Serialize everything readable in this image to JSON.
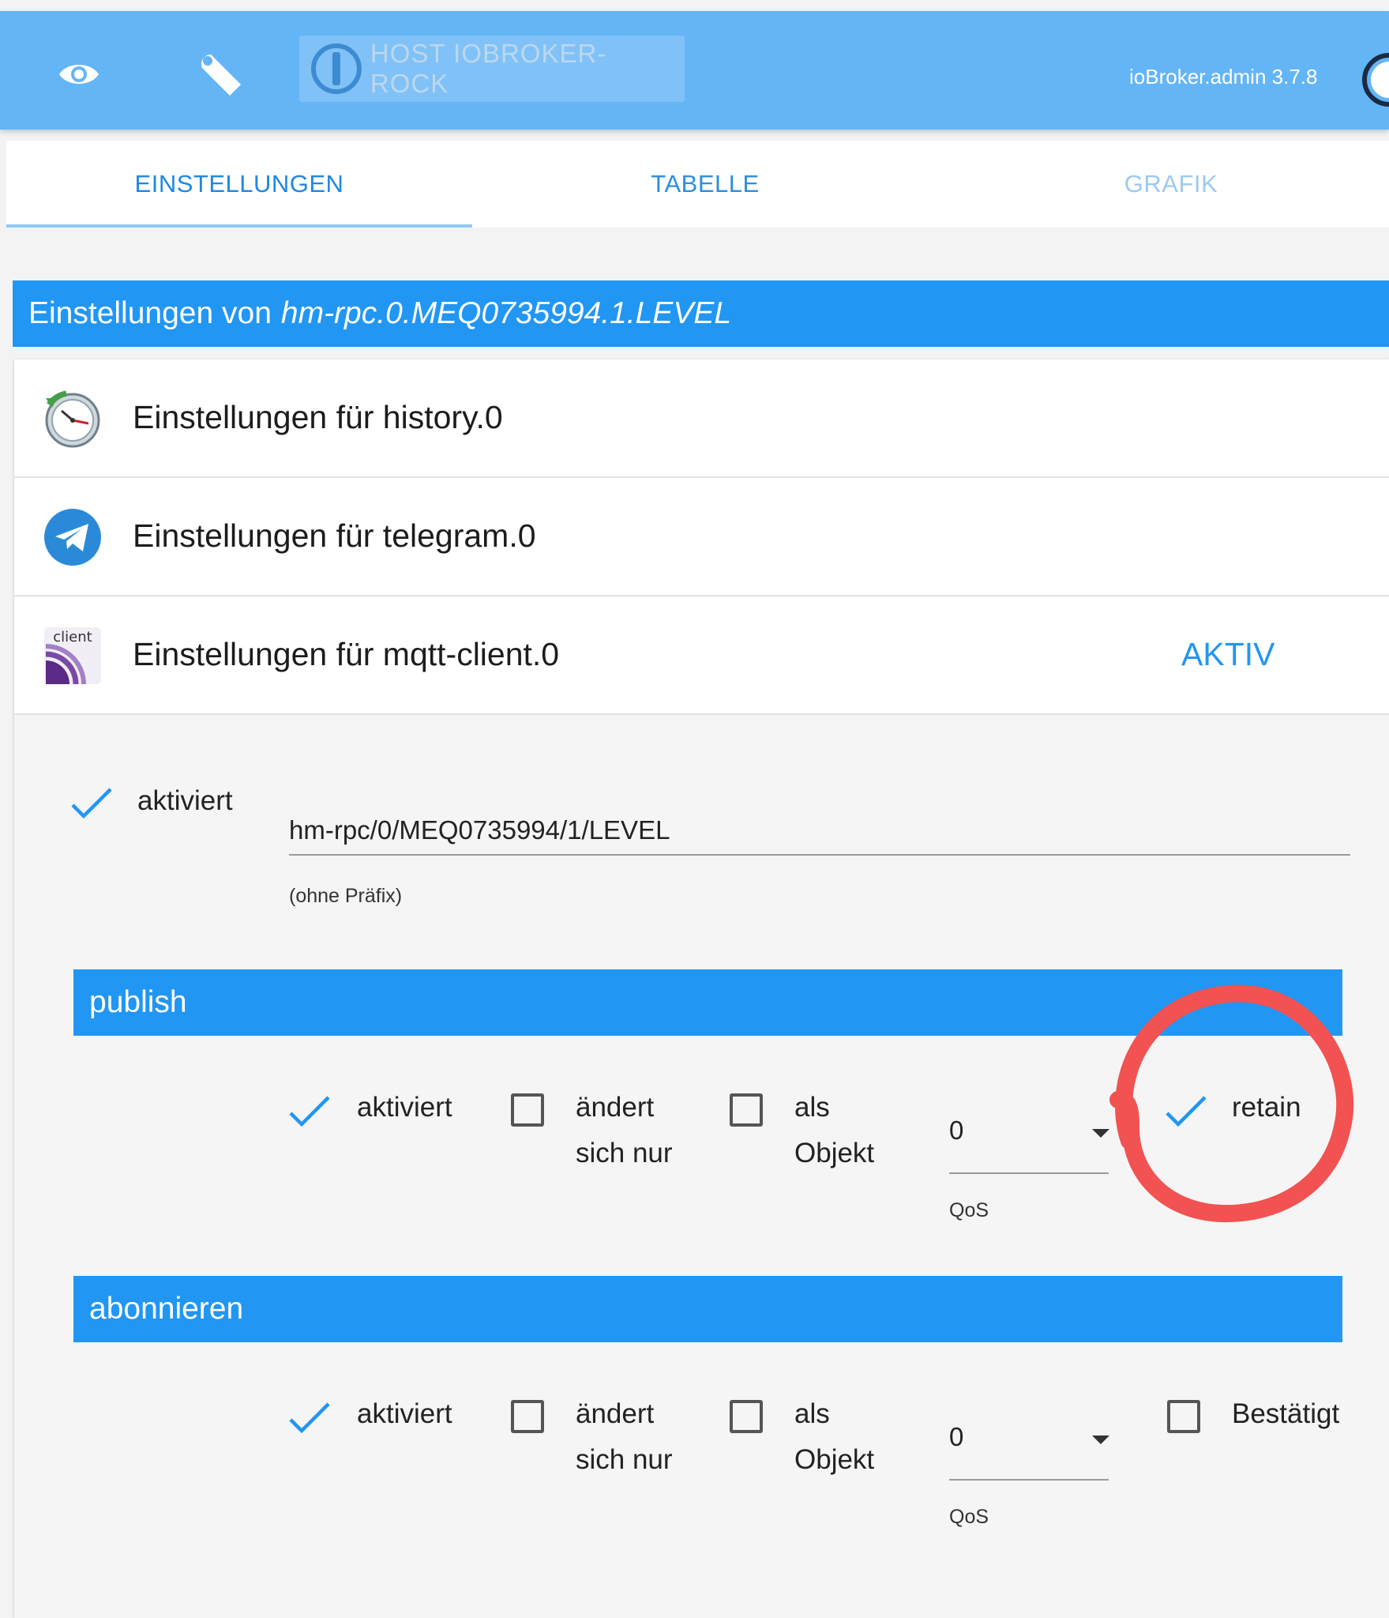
{
  "appbar": {
    "host_label": "HOST IOBROKER-ROCK",
    "version": "ioBroker.admin 3.7.8",
    "color": "#64b5f6",
    "icons": [
      "eye-icon",
      "wrench-icon",
      "iobroker-logo-icon"
    ]
  },
  "tabs": [
    {
      "label": "EINSTELLUNGEN",
      "state": "active"
    },
    {
      "label": "TABELLE",
      "state": "normal"
    },
    {
      "label": "GRAFIK",
      "state": "disabled"
    }
  ],
  "settings_header": {
    "prefix": "Einstellungen von",
    "object_id": "hm-rpc.0.MEQ0735994.1.LEVEL"
  },
  "adapters": [
    {
      "title": "Einstellungen für history.0",
      "icon": "history-clock-icon",
      "status": ""
    },
    {
      "title": "Einstellungen für telegram.0",
      "icon": "telegram-icon",
      "status": ""
    },
    {
      "title": "Einstellungen für mqtt-client.0",
      "icon": "mqtt-client-icon",
      "icon_text": "client",
      "status": "AKTIV"
    }
  ],
  "mqtt": {
    "enabled_label": "aktiviert",
    "enabled": true,
    "topic_value": "hm-rpc/0/MEQ0735994/1/LEVEL",
    "topic_hint": "(ohne Präfix)",
    "publish": {
      "title": "publish",
      "enabled_label": "aktiviert",
      "enabled": true,
      "changes_only_line1": "ändert",
      "changes_only_line2": "sich nur",
      "changes_only": false,
      "as_object_line1": "als",
      "as_object_line2": "Objekt",
      "as_object": false,
      "qos_value": "0",
      "qos_label": "QoS",
      "retain_label": "retain",
      "retain": true
    },
    "subscribe": {
      "title": "abonnieren",
      "enabled_label": "aktiviert",
      "enabled": true,
      "changes_only_line1": "ändert",
      "changes_only_line2": "sich nur",
      "changes_only": false,
      "as_object_line1": "als",
      "as_object_line2": "Objekt",
      "as_object": false,
      "qos_value": "0",
      "qos_label": "QoS",
      "ack_label": "Bestätigt",
      "ack": false
    }
  },
  "annotation": {
    "shape": "hand-drawn circle",
    "color": "#f25252"
  }
}
